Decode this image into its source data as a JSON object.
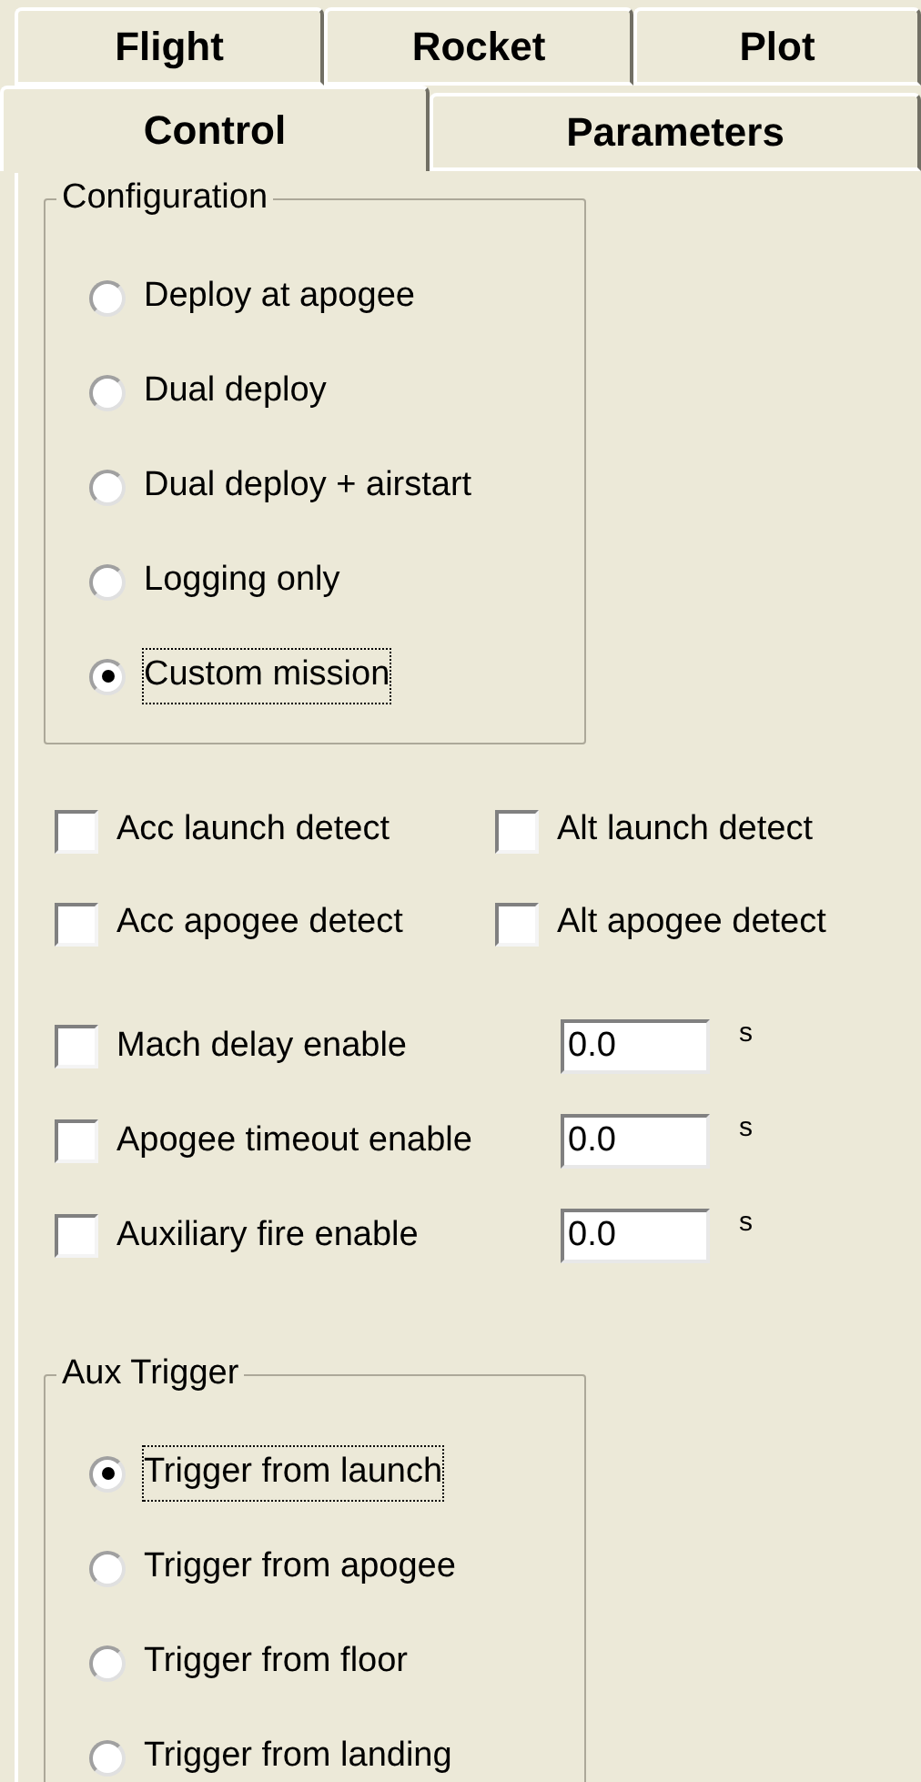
{
  "tab_rows": [
    {
      "tabs": [
        {
          "label": "Flight",
          "selected": false
        },
        {
          "label": "Rocket",
          "selected": false
        },
        {
          "label": "Plot",
          "selected": false
        }
      ]
    },
    {
      "tabs": [
        {
          "label": "Control",
          "selected": true
        },
        {
          "label": "Parameters",
          "selected": false
        }
      ]
    }
  ],
  "configuration": {
    "title": "Configuration",
    "options": [
      {
        "label": "Deploy at apogee",
        "selected": false
      },
      {
        "label": "Dual deploy",
        "selected": false
      },
      {
        "label": "Dual deploy + airstart",
        "selected": false
      },
      {
        "label": "Logging only",
        "selected": false
      },
      {
        "label": "Custom mission",
        "selected": true
      }
    ]
  },
  "detect_options": [
    {
      "label": "Acc launch detect",
      "checked": false
    },
    {
      "label": "Alt launch detect",
      "checked": false
    },
    {
      "label": "Acc apogee detect",
      "checked": false
    },
    {
      "label": "Alt apogee detect",
      "checked": false
    }
  ],
  "timers": [
    {
      "label": "Mach delay enable",
      "checked": false,
      "value": "0.0",
      "unit": "s"
    },
    {
      "label": "Apogee timeout enable",
      "checked": false,
      "value": "0.0",
      "unit": "s"
    },
    {
      "label": "Auxiliary fire enable",
      "checked": false,
      "value": "0.0",
      "unit": "s"
    }
  ],
  "aux_trigger": {
    "title": "Aux Trigger",
    "options": [
      {
        "label": "Trigger from launch",
        "selected": true
      },
      {
        "label": "Trigger from apogee",
        "selected": false
      },
      {
        "label": "Trigger from floor",
        "selected": false
      },
      {
        "label": "Trigger from landing",
        "selected": false
      }
    ]
  }
}
